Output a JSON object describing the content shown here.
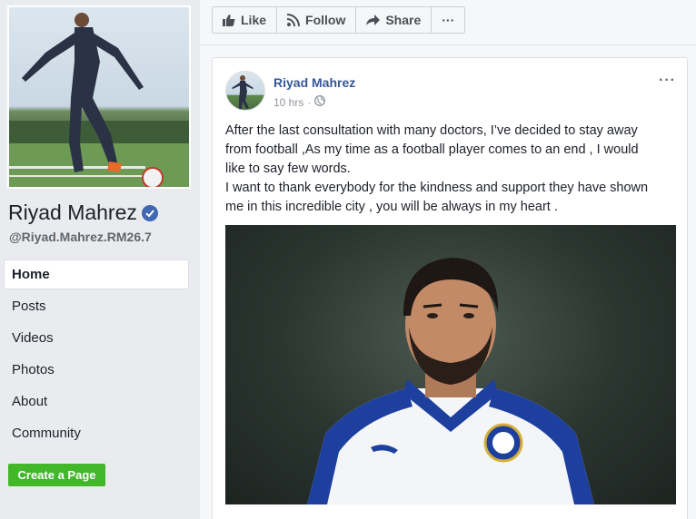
{
  "page": {
    "name": "Riyad Mahrez",
    "username": "@Riyad.Mahrez.RM26.7",
    "verified": true
  },
  "nav": {
    "items": [
      {
        "label": "Home",
        "active": true
      },
      {
        "label": "Posts",
        "active": false
      },
      {
        "label": "Videos",
        "active": false
      },
      {
        "label": "Photos",
        "active": false
      },
      {
        "label": "About",
        "active": false
      },
      {
        "label": "Community",
        "active": false
      }
    ]
  },
  "create_page_label": "Create a Page",
  "actions": {
    "like_label": "Like",
    "follow_label": "Follow",
    "share_label": "Share",
    "more_label": "···"
  },
  "post": {
    "author": "Riyad Mahrez",
    "time": "10 hrs",
    "privacy_icon": "globe-icon",
    "more_label": "···",
    "paragraphs": [
      "After the last consultation with many doctors, I’ve decided to stay away",
      "from football ,As my time as a football player comes to an end , I would",
      "like to say few words.",
      "I want to thank everybody for the kindness and support they have shown",
      "me in this incredible city , you will be always in my heart ."
    ]
  },
  "colors": {
    "brand_blue": "#4267b2",
    "link_blue": "#365899",
    "green": "#42b72a",
    "background": "#e9ebee"
  }
}
